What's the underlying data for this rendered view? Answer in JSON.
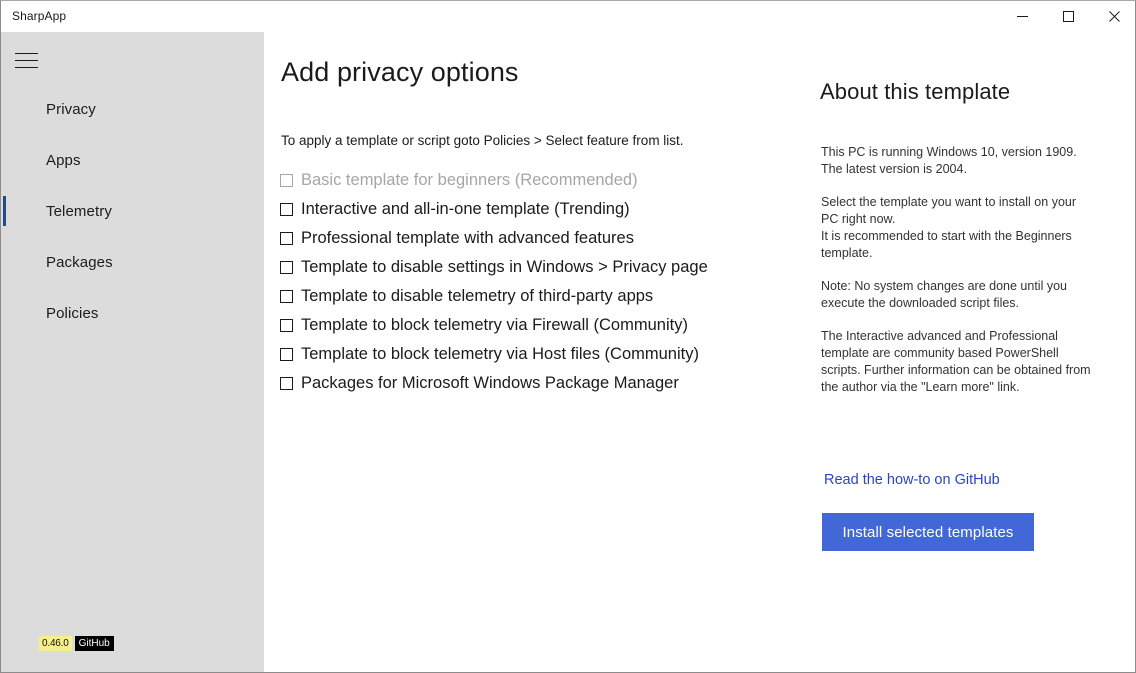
{
  "window": {
    "title": "SharpApp",
    "controls": [
      {
        "name": "minimize-button",
        "glyph": "minimize-icon",
        "label": "Minimize"
      },
      {
        "name": "maximize-button",
        "glyph": "maximize-icon",
        "label": "Maximize"
      },
      {
        "name": "close-button",
        "glyph": "close-icon",
        "label": "Close"
      }
    ]
  },
  "sidebar": {
    "menu_icon": "hamburger-icon",
    "items": [
      {
        "label": "Privacy",
        "selected": false
      },
      {
        "label": "Apps",
        "selected": false
      },
      {
        "label": "Telemetry",
        "selected": true
      },
      {
        "label": "Packages",
        "selected": false
      },
      {
        "label": "Policies",
        "selected": false
      }
    ],
    "badges": {
      "version": "0.46.0",
      "github": "GitHub"
    }
  },
  "main": {
    "title": "Add privacy options",
    "subtitle": "To apply a template or script goto Policies > Select feature from list.",
    "options": [
      {
        "label": "Basic template for beginners (Recommended)",
        "checked": false,
        "disabled": true
      },
      {
        "label": "Interactive and all-in-one template (Trending)",
        "checked": false,
        "disabled": false
      },
      {
        "label": "Professional template with advanced features",
        "checked": false,
        "disabled": false
      },
      {
        "label": "Template to disable settings in Windows > Privacy page",
        "checked": false,
        "disabled": false
      },
      {
        "label": "Template to disable telemetry of third-party apps",
        "checked": false,
        "disabled": false
      },
      {
        "label": "Template to block telemetry via Firewall (Community)",
        "checked": false,
        "disabled": false
      },
      {
        "label": "Template to block telemetry via Host files (Community)",
        "checked": false,
        "disabled": false
      },
      {
        "label": "Packages for Microsoft Windows Package Manager",
        "checked": false,
        "disabled": false
      }
    ]
  },
  "about": {
    "title": "About this template",
    "paragraphs": [
      "This PC is running Windows 10, version 1909.\nThe latest version is 2004.",
      "Select the template you want to install on your PC right now.\nIt is recommended to start with the Beginners template.",
      "Note: No system changes are done until you execute the downloaded script files.",
      "The Interactive advanced and Professional template are community based PowerShell scripts. Further information can be obtained from the author via the \"Learn more\" link."
    ],
    "link_label": "Read the how-to on GitHub",
    "install_button_label": "Install selected templates"
  },
  "colors": {
    "accent_selected": "#1f4e87",
    "button_primary": "#4267d6",
    "link": "#2b44c7",
    "sidebar_bg": "#dcdcdc",
    "badge_version_bg": "#f5f08c",
    "badge_github_bg": "#000000",
    "disabled_text": "#a6a6a6"
  }
}
